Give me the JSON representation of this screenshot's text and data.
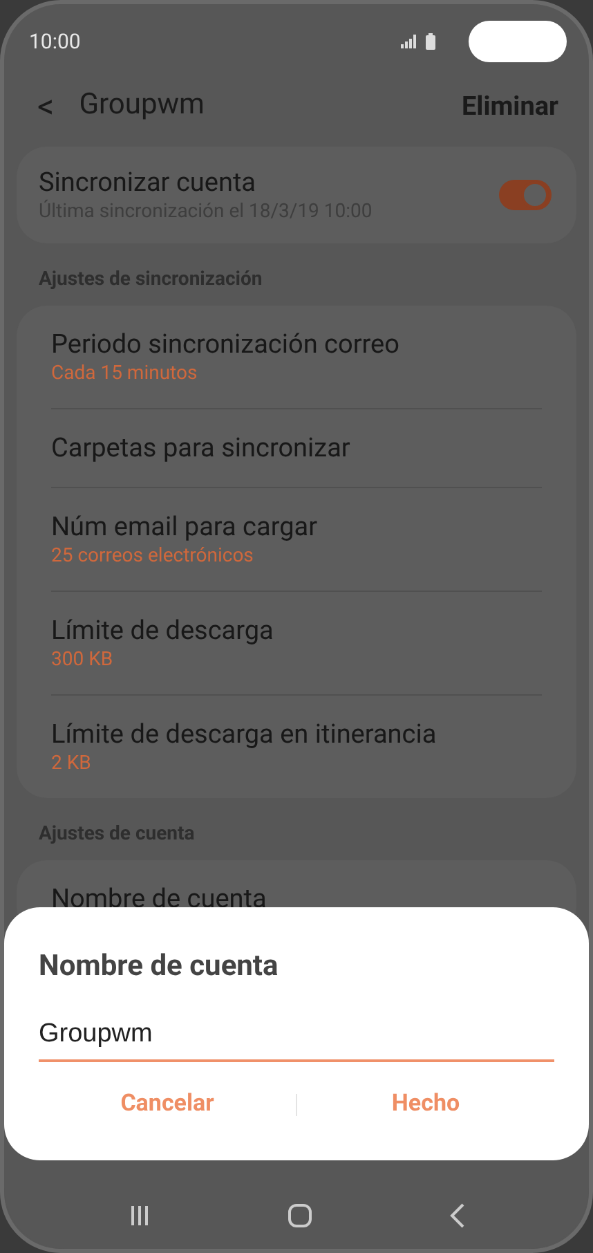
{
  "status_bar": {
    "time": "10:00"
  },
  "header": {
    "back": "<",
    "title": "Groupwm",
    "action": "Eliminar"
  },
  "sync": {
    "title": "Sincronizar cuenta",
    "subtitle": "Última sincronización el 18/3/19  10:00",
    "on": true
  },
  "sections": [
    {
      "heading": "Ajustes de sincronización",
      "items": [
        {
          "title": "Periodo sincronización correo",
          "value": "Cada 15 minutos"
        },
        {
          "title": "Carpetas para sincronizar"
        },
        {
          "title": "Núm email para cargar",
          "value": "25 correos electrónicos"
        },
        {
          "title": "Límite de descarga",
          "value": "300 KB"
        },
        {
          "title": "Límite de descarga en itinerancia",
          "value": "2 KB"
        }
      ]
    },
    {
      "heading": "Ajustes de cuenta",
      "items": [
        {
          "title": "Nombre de cuenta"
        }
      ]
    }
  ],
  "dialog": {
    "title": "Nombre de cuenta",
    "value": "Groupwm",
    "buttons": [
      "Cancelar",
      "Hecho"
    ]
  }
}
